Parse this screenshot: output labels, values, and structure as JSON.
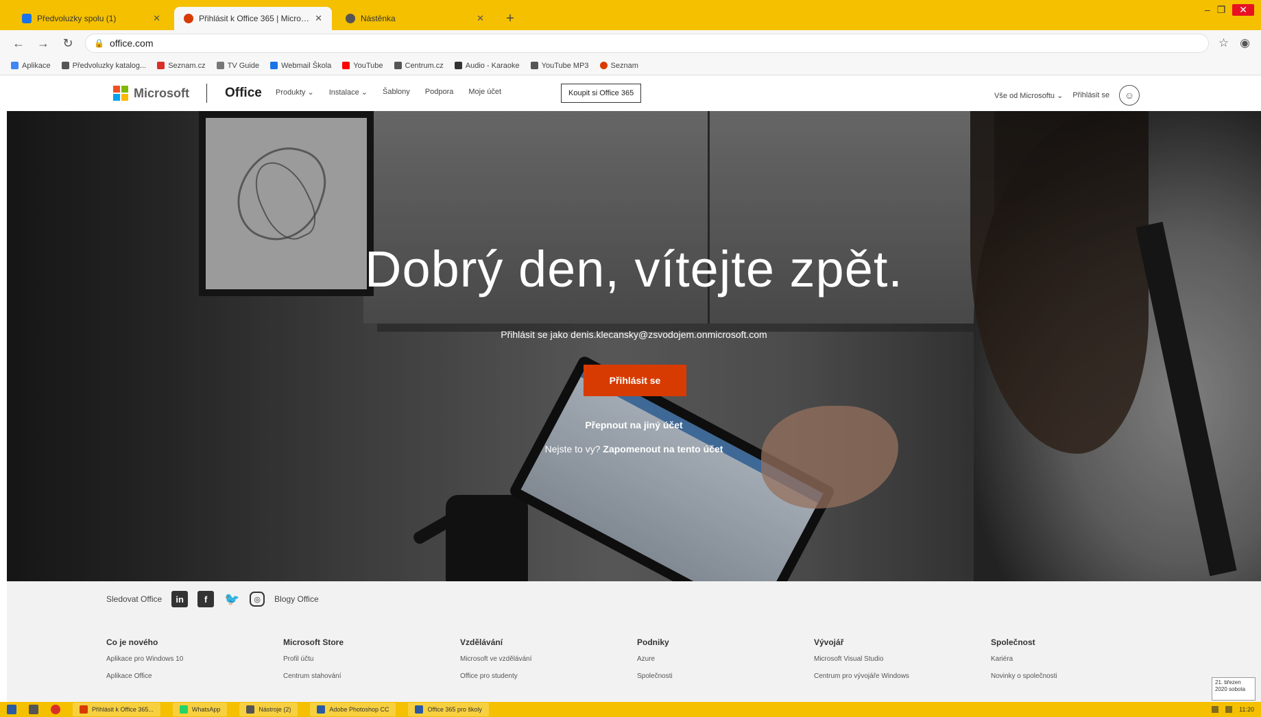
{
  "browser": {
    "tabs": [
      {
        "title": "Předvoluzky spolu (1)",
        "active": false,
        "favicon_color": "#1a73e8"
      },
      {
        "title": "Přihlásit k Office 365 | Microsoft",
        "active": true,
        "favicon_color": "#d83b01"
      },
      {
        "title": "Nástěnka",
        "active": false,
        "favicon_color": "#555555"
      }
    ],
    "newtab_symbol": "+",
    "window_controls": {
      "minimize": "–",
      "maximize": "❐",
      "close": "✕"
    },
    "url": "office.com",
    "bookmarks": [
      {
        "label": "Aplikace",
        "color": "#4285f4"
      },
      {
        "label": "Předvoluzky katalog...",
        "color": "#555555"
      },
      {
        "label": "Seznam.cz",
        "color": "#d93025"
      },
      {
        "label": "TV Guide",
        "color": "#777777"
      },
      {
        "label": "Webmail Škola",
        "color": "#1a73e8"
      },
      {
        "label": "YouTube",
        "color": "#ff0000"
      },
      {
        "label": "Centrum.cz",
        "color": "#555555"
      },
      {
        "label": "Audio - Karaoke",
        "color": "#333333"
      },
      {
        "label": "YouTube MP3",
        "color": "#555555"
      },
      {
        "label": "Seznam",
        "color": "#d83b01"
      }
    ]
  },
  "office_header": {
    "brand": "Microsoft",
    "product": "Office",
    "nav": [
      "Produkty ⌄",
      "Instalace ⌄",
      "Šablony",
      "Podpora",
      "Moje účet"
    ],
    "buy_label": "Koupit si Office 365",
    "all_microsoft": "Vše od Microsoftu ⌄",
    "signin_label": "Přihlásit se"
  },
  "hero": {
    "greeting": "Dobrý den, vítejte zpět.",
    "signed_in_as": "Přihlásit se jako denis.klecansky@zsvodojem.onmicrosoft.com",
    "signin_button": "Přihlásit se",
    "switch_account": "Přepnout na jiný účet",
    "not_you_prefix": "Nejste to vy?",
    "not_you_link": "Zapomenout na tento účet"
  },
  "footer": {
    "follow_label": "Sledovat Office",
    "social": [
      {
        "name": "linkedin",
        "glyph": "in"
      },
      {
        "name": "facebook",
        "glyph": "f"
      },
      {
        "name": "twitter",
        "glyph": "🐦"
      },
      {
        "name": "instagram",
        "glyph": "◎"
      }
    ],
    "blogs_label": "Blogy Office",
    "columns": [
      {
        "heading": "Co je nového",
        "links": [
          "Aplikace pro Windows 10",
          "Aplikace Office"
        ]
      },
      {
        "heading": "Microsoft Store",
        "links": [
          "Profil účtu",
          "Centrum stahování"
        ]
      },
      {
        "heading": "Vzdělávání",
        "links": [
          "Microsoft ve vzdělávání",
          "Office pro studenty"
        ]
      },
      {
        "heading": "Podniky",
        "links": [
          "Azure",
          "Společnosti"
        ]
      },
      {
        "heading": "Vývojář",
        "links": [
          "Microsoft Visual Studio",
          "Centrum pro vývojáře Windows"
        ]
      },
      {
        "heading": "Společnost",
        "links": [
          "Kariéra",
          "Novinky o společnosti"
        ]
      }
    ],
    "tooltip": "21. březen 2020 sobota"
  },
  "taskbar": {
    "items": [
      {
        "label": "Přihlásit k Office 365...",
        "color": "#d83b01"
      },
      {
        "label": "WhatsApp",
        "color": "#25d366"
      },
      {
        "label": "Nástroje (2)",
        "color": "#555555"
      },
      {
        "label": "Adobe Photoshop CC",
        "color": "#2a5aa6"
      },
      {
        "label": "Office 365 pro školy",
        "color": "#2a5aa6"
      }
    ],
    "clock": "11:20"
  }
}
